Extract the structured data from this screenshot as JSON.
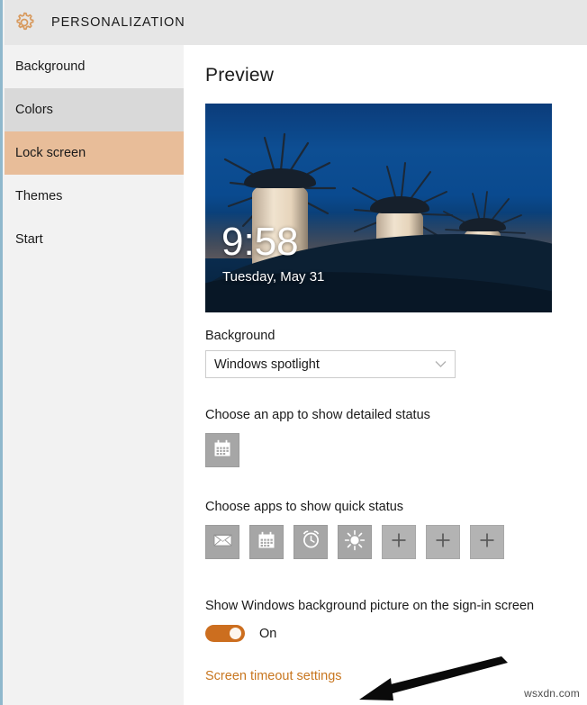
{
  "window": {
    "title": "PERSONALIZATION",
    "gear_icon": "gear-icon",
    "header_bg": "#e6e6e6"
  },
  "sidebar": {
    "items": [
      {
        "label": "Background",
        "state": "normal"
      },
      {
        "label": "Colors",
        "state": "hover"
      },
      {
        "label": "Lock screen",
        "state": "selected"
      },
      {
        "label": "Themes",
        "state": "normal"
      },
      {
        "label": "Start",
        "state": "normal"
      }
    ],
    "selected_bg": "#e8bd99",
    "hover_bg": "#d9d9d9",
    "bg": "#f2f2f2"
  },
  "main": {
    "heading": "Preview",
    "preview": {
      "time": "9:58",
      "date": "Tuesday, May 31",
      "scene": "windmills-at-dusk"
    },
    "background_section": {
      "label": "Background",
      "dropdown_value": "Windows spotlight",
      "dropdown_icon": "chevron-down-icon"
    },
    "detailed_status": {
      "label": "Choose an app to show detailed status",
      "tiles": [
        {
          "icon": "calendar-icon",
          "empty": false
        }
      ]
    },
    "quick_status": {
      "label": "Choose apps to show quick status",
      "tiles": [
        {
          "icon": "mail-icon",
          "empty": false
        },
        {
          "icon": "calendar-icon",
          "empty": false
        },
        {
          "icon": "alarm-clock-icon",
          "empty": false
        },
        {
          "icon": "weather-sun-icon",
          "empty": false
        },
        {
          "icon": "plus-icon",
          "empty": true
        },
        {
          "icon": "plus-icon",
          "empty": true
        },
        {
          "icon": "plus-icon",
          "empty": true
        }
      ]
    },
    "signin_section": {
      "label": "Show Windows background picture on the sign-in screen",
      "toggle_state": "On",
      "toggle_on": true,
      "toggle_color": "#cc6e1f"
    },
    "link": {
      "label": "Screen timeout settings",
      "color": "#c8761f"
    }
  },
  "annotation": {
    "arrow_icon": "arrow-left-icon",
    "color": "#000000"
  },
  "watermark": {
    "text": "wsxdn.com"
  }
}
